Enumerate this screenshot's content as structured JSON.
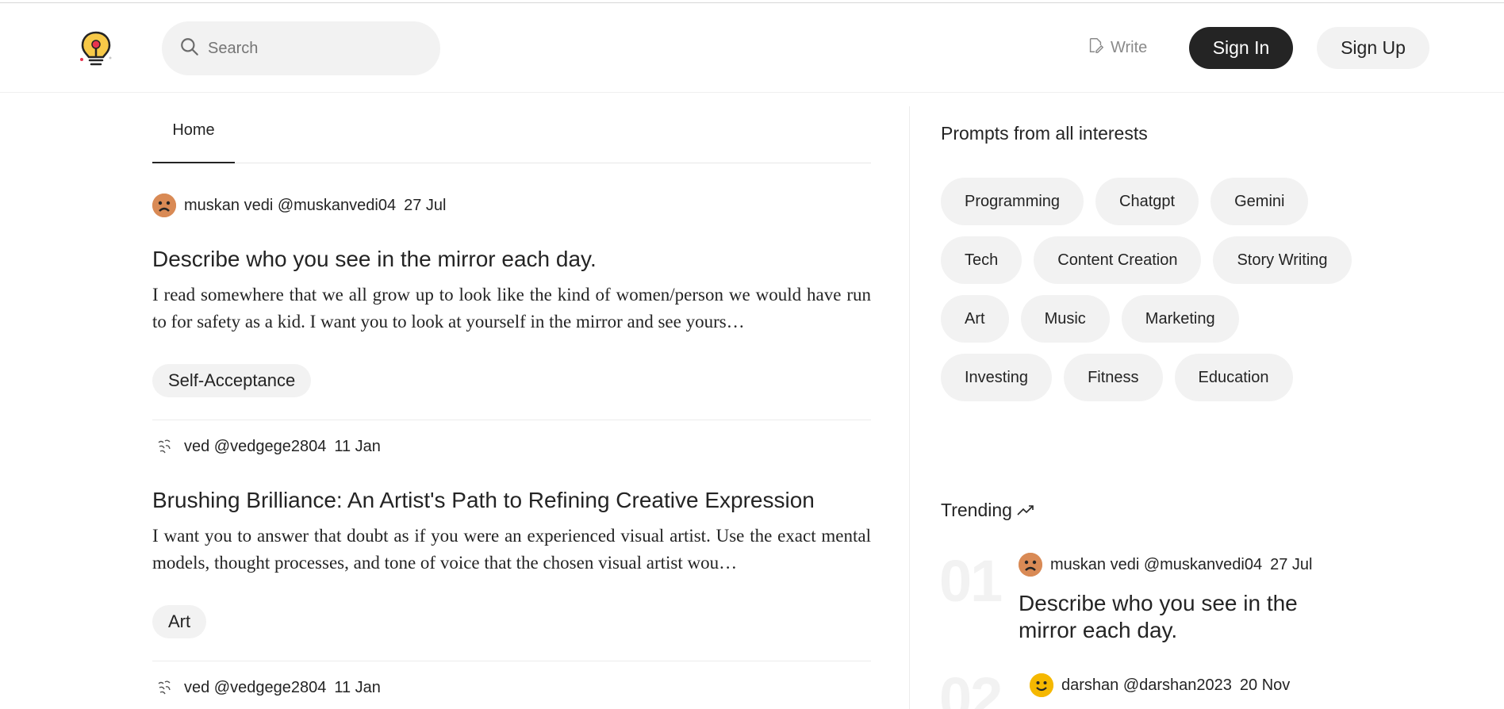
{
  "header": {
    "search_placeholder": "Search",
    "write_label": "Write",
    "signin_label": "Sign In",
    "signup_label": "Sign Up"
  },
  "tabs": {
    "home_label": "Home"
  },
  "posts": [
    {
      "author": "muskan vedi @muskanvedi04",
      "date": "27 Jul",
      "title": "Describe who you see in the mirror each day.",
      "body": "I read somewhere that we all grow up to look like the kind of women/person we would have run to for safety as a kid. I want you to look at yourself in the mirror and see yours…",
      "tag": "Self-Acceptance"
    },
    {
      "author": "ved @vedgege2804",
      "date": "11 Jan",
      "title": "Brushing Brilliance: An Artist's Path to Refining Creative Expression",
      "body": "I want you to answer that doubt as if you were an experienced visual artist. Use the exact mental models, thought processes, and tone of voice that the chosen visual artist wou…",
      "tag": "Art"
    },
    {
      "author": "ved @vedgege2804",
      "date": "11 Jan"
    }
  ],
  "sidebar": {
    "prompts_title": "Prompts from all interests",
    "interests": [
      "Programming",
      "Chatgpt",
      "Gemini",
      "Tech",
      "Content Creation",
      "Story Writing",
      "Art",
      "Music",
      "Marketing",
      "Investing",
      "Fitness",
      "Education"
    ],
    "trending_title": "Trending",
    "trending": [
      {
        "num": "01",
        "author": "muskan vedi @muskanvedi04",
        "date": "27 Jul",
        "title": "Describe who you see in the mirror each day."
      },
      {
        "num": "02",
        "author": "darshan @darshan2023",
        "date": "20 Nov"
      }
    ]
  },
  "colors": {
    "accent_dark": "#242424",
    "chip_bg": "#f2f2f2",
    "avatar_orange": "#d98a55",
    "avatar_yellow": "#f5b800"
  }
}
